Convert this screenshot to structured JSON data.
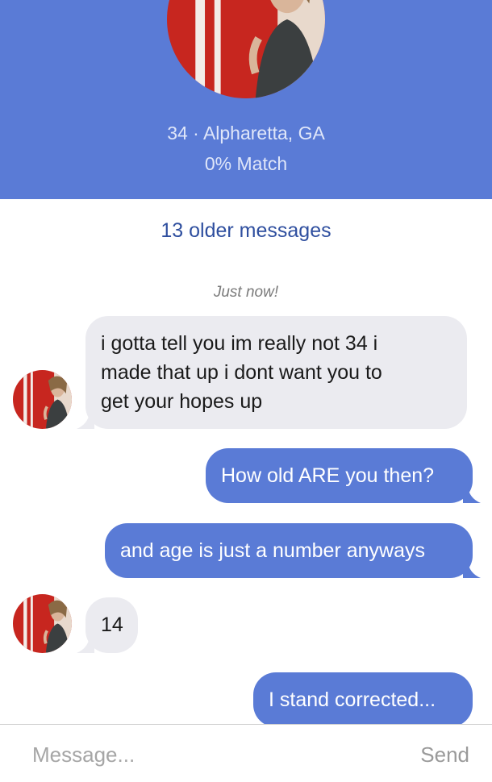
{
  "profile": {
    "photo_icon": "profile-photo",
    "age_location": "34 · Alpharetta, GA",
    "match": "0% Match"
  },
  "thread": {
    "older_messages": "13 older messages",
    "timestamp": "Just now!",
    "messages": [
      {
        "side": "in",
        "lines": [
          "i gotta tell you im really not 34 i",
          "made that up i dont want you to",
          "get your hopes up"
        ]
      },
      {
        "side": "out",
        "lines": [
          "How old ARE you then?"
        ]
      },
      {
        "side": "out",
        "lines": [
          "and age is just a number anyways"
        ]
      },
      {
        "side": "in",
        "lines": [
          "14"
        ]
      },
      {
        "side": "out",
        "lines": [
          "I stand corrected..."
        ]
      }
    ]
  },
  "composer": {
    "placeholder": "Message...",
    "send_label": "Send"
  },
  "colors": {
    "accent": "#5a7bd6",
    "incoming_bubble": "#ebebf0",
    "link": "#2f4f9f"
  }
}
